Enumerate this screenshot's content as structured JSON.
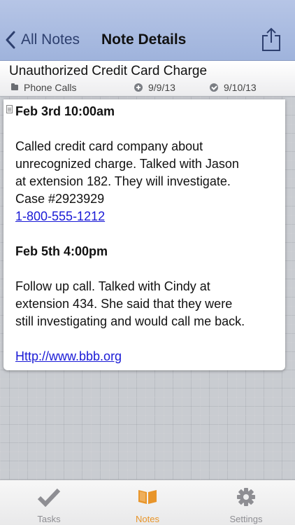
{
  "navbar": {
    "back_label": "All Notes",
    "title": "Note Details"
  },
  "note": {
    "title": "Unauthorized Credit Card Charge",
    "folder": "Phone Calls",
    "created": "9/9/13",
    "modified": "9/10/13"
  },
  "body": {
    "entry1_heading": "Feb  3rd 10:00am",
    "entry1_lines": [
      "Called credit card company about",
      "unrecognized charge. Talked with Jason",
      "at extension 182. They will investigate.",
      "Case #2923929"
    ],
    "entry1_phone": "1-800-555-1212",
    "entry2_heading": "Feb  5th 4:00pm",
    "entry2_lines": [
      "Follow up call. Talked with Cindy at",
      "extension 434. She said that they were",
      "still investigating and would call me back."
    ],
    "link": "Http://www.bbb.org"
  },
  "tabbar": {
    "tasks": "Tasks",
    "notes": "Notes",
    "settings": "Settings"
  },
  "colors": {
    "navbar": "#a9bbe1",
    "accent_active_tab": "#e8952a",
    "link": "#1a1ad6"
  },
  "icons": {
    "back": "chevron-left-icon",
    "share": "share-icon",
    "folder": "folder-icon",
    "created": "plus-circle-icon",
    "modified": "check-circle-icon",
    "note": "note-page-icon",
    "tasks_tab": "checkmark-icon",
    "notes_tab": "open-book-icon",
    "settings_tab": "gear-icon"
  }
}
